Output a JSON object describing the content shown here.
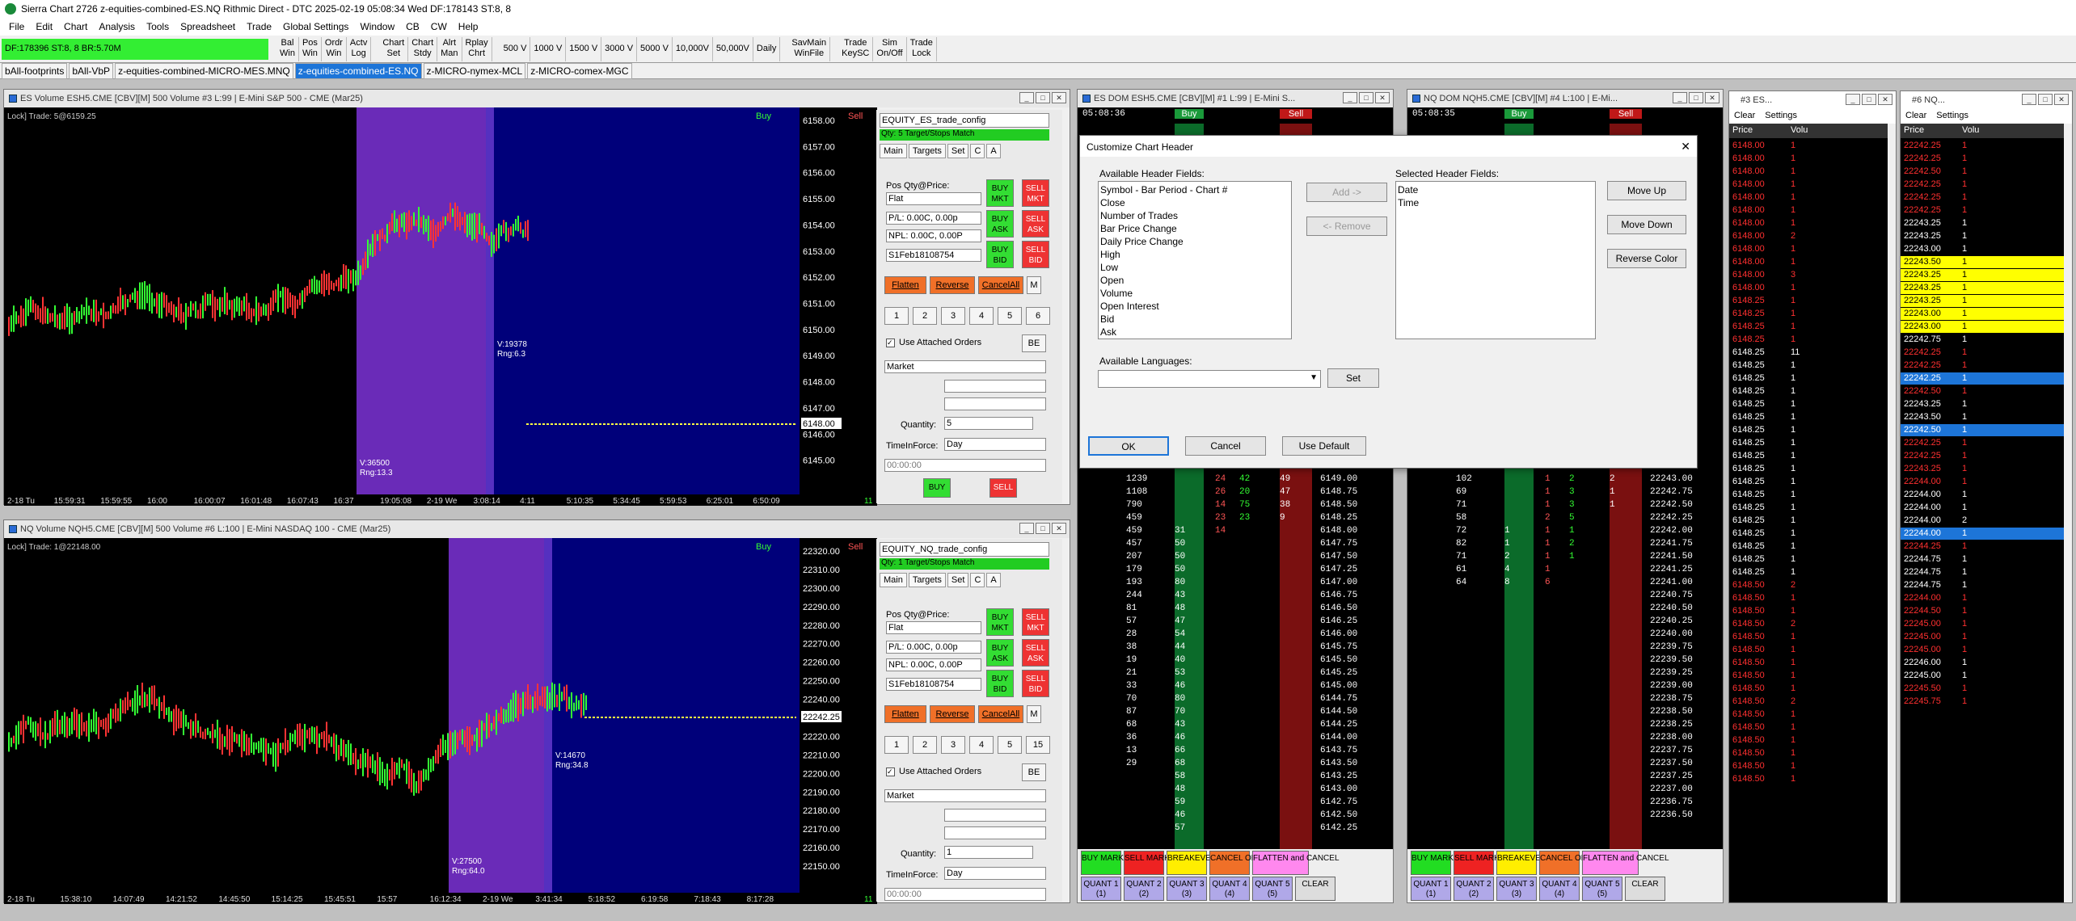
{
  "app": {
    "title": "Sierra Chart 2726 z-equities-combined-ES.NQ Rithmic Direct - DTC 2025-02-19  05:08:34 Wed DF:178143  ST:8, 8"
  },
  "menu": [
    "File",
    "Edit",
    "Chart",
    "Analysis",
    "Tools",
    "Spreadsheet",
    "Trade",
    "Global Settings",
    "Window",
    "CB",
    "CW",
    "Help"
  ],
  "toolbar": {
    "status": "DF:178396  ST:8, 8  BR:5.70M",
    "group1": [
      "Bal\nWin",
      "Pos\nWin",
      "Ordr\nWin",
      "Actv\nLog"
    ],
    "group2": [
      "Chart\nSet",
      "Chart\nStdy",
      "Alrt\nMan",
      "Rplay\nChrt"
    ],
    "group3": [
      "500 V",
      "1000 V",
      "1500 V",
      "3000 V",
      "5000 V",
      "10,000V",
      "50,000V",
      "Daily"
    ],
    "group4": [
      "SavMain\nWinFile"
    ],
    "group5": [
      "Trade\nKeySC",
      "Sim\nOn/Off",
      "Trade\nLock"
    ]
  },
  "chartbooks": [
    "bAll-footprints",
    "bAll-VbP",
    "z-equities-combined-MICRO-MES.MNQ",
    "z-equities-combined-ES.NQ",
    "z-MICRO-nymex-MCL",
    "z-MICRO-comex-MGC"
  ],
  "es_chart": {
    "title": "ES Volume ESH5.CME [CBV][M]  500 Volume #3 L:99 | E-Mini S&P 500 - CME (Mar25)",
    "header": "Lock] Trade: 5@6159.25",
    "buy_label": "Buy",
    "sell_label": "Sell",
    "prices": [
      "6158.00",
      "6157.00",
      "6156.00",
      "6155.00",
      "6154.00",
      "6153.00",
      "6152.00",
      "6151.00",
      "6150.00",
      "6149.00",
      "6148.00",
      "6147.00",
      "6146.00",
      "6145.00"
    ],
    "current_price": "6148.00",
    "times": [
      "2-18 Tu",
      "15:59:31",
      "15:59:55",
      "16:00",
      "16:00:07",
      "16:01:48",
      "16:07:43",
      "16:37",
      "19:05:08",
      "2-19 We",
      "3:08:14",
      "4:11",
      "5:10:35",
      "5:34:45",
      "5:59:53",
      "6:25:01",
      "6:50:09"
    ],
    "annot1": "V:36500\nRng:13.3",
    "annot2": "V:19378\nRng:6.3",
    "corner_count": "11"
  },
  "nq_chart": {
    "title": "NQ Volume NQH5.CME [CBV][M]  500 Volume #6 L:100 | E-Mini NASDAQ 100 - CME (Mar25)",
    "header": "Lock] Trade: 1@22148.00",
    "buy_label": "Buy",
    "sell_label": "Sell",
    "prices": [
      "22320.00",
      "22310.00",
      "22300.00",
      "22290.00",
      "22280.00",
      "22270.00",
      "22260.00",
      "22250.00",
      "22240.00",
      "22230.00",
      "22220.00",
      "22210.00",
      "22200.00",
      "22190.00",
      "22180.00",
      "22170.00",
      "22160.00",
      "22150.00"
    ],
    "current_price": "22242.25",
    "times": [
      "2-18 Tu",
      "15:38:10",
      "14:07:49",
      "14:21:52",
      "14:45:50",
      "15:14:25",
      "15:45:51",
      "15:57",
      "16:12:34",
      "2-19 We",
      "3:41:34",
      "5:18:52",
      "6:19:58",
      "7:18:43",
      "8:17:28"
    ],
    "annot1": "V:27500\nRng:64.0",
    "annot2": "V:14670\nRng:34.8",
    "corner_count": "11"
  },
  "es_trade": {
    "config": "EQUITY_ES_trade_config",
    "qty_line": "Qty: 5 Target/Stops Match",
    "tabs": [
      "Main",
      "Targets",
      "Set",
      "C",
      "A"
    ],
    "pos_label": "Pos Qty@Price:",
    "pos_value": "Flat",
    "pl": "P/L: 0.00C, 0.00p",
    "npl": "NPL: 0.00C, 0.00P",
    "account": "S1Feb18108754",
    "buy_mkt": "BUY\nMKT",
    "sell_mkt": "SELL\nMKT",
    "buy_ask": "BUY\nASK",
    "sell_ask": "SELL\nASK",
    "buy_bid": "BUY\nBID",
    "sell_bid": "SELL\nBID",
    "flatten": "Flatten",
    "reverse": "Reverse",
    "cancel_all": "CancelAll",
    "m": "M",
    "quants": [
      "1",
      "2",
      "3",
      "4",
      "5",
      "6"
    ],
    "use_attached": "Use Attached Orders",
    "be": "BE",
    "order_type": "Market",
    "quantity_label": "Quantity:",
    "quantity": "5",
    "tif_label": "TimeInForce:",
    "tif": "Day",
    "time": "00:00:00",
    "buy": "BUY",
    "sell": "SELL"
  },
  "nq_trade": {
    "config": "EQUITY_NQ_trade_config",
    "qty_line": "Qty: 1 Target/Stops Match",
    "tabs": [
      "Main",
      "Targets",
      "Set",
      "C",
      "A"
    ],
    "pos_label": "Pos Qty@Price:",
    "pos_value": "Flat",
    "pl": "P/L: 0.00C, 0.00p",
    "npl": "NPL: 0.00C, 0.00P",
    "account": "S1Feb18108754",
    "buy_mkt": "BUY\nMKT",
    "sell_mkt": "SELL\nMKT",
    "buy_ask": "BUY\nASK",
    "sell_ask": "SELL\nASK",
    "buy_bid": "BUY\nBID",
    "sell_bid": "SELL\nBID",
    "flatten": "Flatten",
    "reverse": "Reverse",
    "cancel_all": "CancelAll",
    "m": "M",
    "quants": [
      "1",
      "2",
      "3",
      "4",
      "5",
      "15"
    ],
    "use_attached": "Use Attached Orders",
    "be": "BE",
    "order_type": "Market",
    "quantity_label": "Quantity:",
    "quantity": "1",
    "tif_label": "TimeInForce:",
    "tif": "Day",
    "time": "00:00:00"
  },
  "es_dom": {
    "title": "ES DOM ESH5.CME [CBV][M] #1 L:99 | E-Mini S...",
    "time": "05:08:36",
    "buy": "Buy",
    "sell": "Sell",
    "rows": [
      [
        "1239",
        "",
        "24",
        "42",
        "49",
        "6149.00"
      ],
      [
        "1108",
        "",
        "26",
        "20",
        "47",
        "6148.75"
      ],
      [
        "790",
        "",
        "14",
        "75",
        "38",
        "6148.50"
      ],
      [
        "459",
        "",
        "23",
        "23",
        "9",
        "6148.25"
      ],
      [
        "459",
        "31",
        "14",
        "",
        "",
        "6148.00"
      ],
      [
        "457",
        "50",
        "",
        "",
        "",
        "6147.75"
      ],
      [
        "207",
        "50",
        "",
        "",
        "",
        "6147.50"
      ],
      [
        "179",
        "50",
        "",
        "",
        "",
        "6147.25"
      ],
      [
        "193",
        "80",
        "",
        "",
        "",
        "6147.00"
      ],
      [
        "244",
        "43",
        "",
        "",
        "",
        "6146.75"
      ],
      [
        "81",
        "48",
        "",
        "",
        "",
        "6146.50"
      ],
      [
        "57",
        "47",
        "",
        "",
        "",
        "6146.25"
      ],
      [
        "28",
        "54",
        "",
        "",
        "",
        "6146.00"
      ],
      [
        "38",
        "44",
        "",
        "",
        "",
        "6145.75"
      ],
      [
        "19",
        "40",
        "",
        "",
        "",
        "6145.50"
      ],
      [
        "21",
        "53",
        "",
        "",
        "",
        "6145.25"
      ],
      [
        "33",
        "46",
        "",
        "",
        "",
        "6145.00"
      ],
      [
        "70",
        "80",
        "",
        "",
        "",
        "6144.75"
      ],
      [
        "87",
        "70",
        "",
        "",
        "",
        "6144.50"
      ],
      [
        "68",
        "43",
        "",
        "",
        "",
        "6144.25"
      ],
      [
        "36",
        "46",
        "",
        "",
        "",
        "6144.00"
      ],
      [
        "13",
        "66",
        "",
        "",
        "",
        "6143.75"
      ],
      [
        "29",
        "68",
        "",
        "",
        "",
        "6143.50"
      ],
      [
        "",
        "58",
        "",
        "",
        "",
        "6143.25"
      ],
      [
        "",
        "48",
        "",
        "",
        "",
        "6143.00"
      ],
      [
        "",
        "59",
        "",
        "",
        "",
        "6142.75"
      ],
      [
        "",
        "46",
        "",
        "",
        "",
        "6142.50"
      ],
      [
        "",
        "57",
        "",
        "",
        "",
        "6142.25"
      ]
    ],
    "footer": [
      "BUY MARKET",
      "SELL MARKET",
      "BREAKEVEN",
      "CANCEL ORDERS",
      "FLATTEN and CANCEL",
      "QUANT 1\n(1)",
      "QUANT 2\n(2)",
      "QUANT 3\n(3)",
      "QUANT 4\n(4)",
      "QUANT 5\n(5)",
      "CLEAR"
    ]
  },
  "nq_dom": {
    "title": "NQ DOM NQH5.CME [CBV][M] #4 L:100 | E-Mi...",
    "time": "05:08:35",
    "buy": "Buy",
    "sell": "Sell",
    "rows": [
      [
        "102",
        "",
        "1",
        "2",
        "2",
        "22243.00"
      ],
      [
        "69",
        "",
        "1",
        "3",
        "1",
        "22242.75"
      ],
      [
        "71",
        "",
        "1",
        "3",
        "1",
        "22242.50"
      ],
      [
        "58",
        "",
        "2",
        "5",
        "",
        "22242.25"
      ],
      [
        "72",
        "1",
        "1",
        "1",
        "",
        "22242.00"
      ],
      [
        "82",
        "1",
        "1",
        "2",
        "",
        "22241.75"
      ],
      [
        "71",
        "2",
        "1",
        "1",
        "",
        "22241.50"
      ],
      [
        "61",
        "4",
        "1",
        "",
        "",
        "22241.25"
      ],
      [
        "64",
        "8",
        "6",
        "",
        "",
        "22241.00"
      ],
      [
        "",
        "",
        "",
        "",
        "",
        "22240.75"
      ],
      [
        "",
        "",
        "",
        "",
        "",
        "22240.50"
      ],
      [
        "",
        "",
        "",
        "",
        "",
        "22240.25"
      ],
      [
        "",
        "",
        "",
        "",
        "",
        "22240.00"
      ],
      [
        "",
        "",
        "",
        "",
        "",
        "22239.75"
      ],
      [
        "",
        "",
        "",
        "",
        "",
        "22239.50"
      ],
      [
        "",
        "",
        "",
        "",
        "",
        "22239.25"
      ],
      [
        "",
        "",
        "",
        "",
        "",
        "22239.00"
      ],
      [
        "",
        "",
        "",
        "",
        "",
        "22238.75"
      ],
      [
        "",
        "",
        "",
        "",
        "",
        "22238.50"
      ],
      [
        "",
        "",
        "",
        "",
        "",
        "22238.25"
      ],
      [
        "",
        "",
        "",
        "",
        "",
        "22238.00"
      ],
      [
        "",
        "",
        "",
        "",
        "",
        "22237.75"
      ],
      [
        "",
        "",
        "",
        "",
        "",
        "22237.50"
      ],
      [
        "",
        "",
        "",
        "",
        "",
        "22237.25"
      ],
      [
        "",
        "",
        "",
        "",
        "",
        "22237.00"
      ],
      [
        "",
        "",
        "",
        "",
        "",
        "22236.75"
      ],
      [
        "",
        "",
        "",
        "",
        "",
        "22236.50"
      ]
    ],
    "footer": [
      "BUY MARKET",
      "SELL MARKET",
      "BREAKEVEN",
      "CANCEL ORDERS",
      "FLATTEN and CANCEL",
      "QUANT 1\n(1)",
      "QUANT 2\n(2)",
      "QUANT 3\n(3)",
      "QUANT 4\n(4)",
      "QUANT 5\n(5)",
      "CLEAR"
    ]
  },
  "dialog": {
    "title": "Customize Chart Header",
    "available_label": "Available Header Fields:",
    "available": [
      "Symbol - Bar Period - Chart #",
      "Close",
      "Number of Trades",
      "Bar Price Change",
      "Daily Price Change",
      "High",
      "Low",
      "Open",
      "Volume",
      "Open Interest",
      "Bid",
      "Ask"
    ],
    "selected_label": "Selected Header Fields:",
    "selected": [
      "Date",
      "Time"
    ],
    "add": "Add ->",
    "remove": "<- Remove",
    "move_up": "Move Up",
    "move_down": "Move Down",
    "reverse_color": "Reverse Color",
    "languages_label": "Available Languages:",
    "set": "Set",
    "ok": "OK",
    "cancel": "Cancel",
    "use_default": "Use Default"
  },
  "es_ts": {
    "title": "#3 ES...",
    "clear": "Clear",
    "settings": "Settings",
    "col_price": "Price",
    "col_vol": "Volu",
    "rows": [
      [
        "6148.00",
        "1",
        "r"
      ],
      [
        "6148.00",
        "1",
        "r"
      ],
      [
        "6148.00",
        "1",
        "r"
      ],
      [
        "6148.00",
        "1",
        "r"
      ],
      [
        "6148.00",
        "1",
        "r"
      ],
      [
        "6148.00",
        "1",
        "r"
      ],
      [
        "6148.00",
        "1",
        "r"
      ],
      [
        "6148.00",
        "2",
        "r"
      ],
      [
        "6148.00",
        "1",
        "r"
      ],
      [
        "6148.00",
        "1",
        "r"
      ],
      [
        "6148.00",
        "3",
        "r"
      ],
      [
        "6148.00",
        "1",
        "r"
      ],
      [
        "6148.25",
        "1",
        "r"
      ],
      [
        "6148.25",
        "1",
        "r"
      ],
      [
        "6148.25",
        "1",
        "r"
      ],
      [
        "6148.25",
        "1",
        "r"
      ],
      [
        "6148.25",
        "11",
        "w"
      ],
      [
        "6148.25",
        "1",
        "w"
      ],
      [
        "6148.25",
        "1",
        "w"
      ],
      [
        "6148.25",
        "1",
        "w"
      ],
      [
        "6148.25",
        "1",
        "w"
      ],
      [
        "6148.25",
        "1",
        "w"
      ],
      [
        "6148.25",
        "1",
        "w"
      ],
      [
        "6148.25",
        "1",
        "w"
      ],
      [
        "6148.25",
        "1",
        "w"
      ],
      [
        "6148.25",
        "1",
        "w"
      ],
      [
        "6148.25",
        "1",
        "w"
      ],
      [
        "6148.25",
        "1",
        "w"
      ],
      [
        "6148.25",
        "1",
        "w"
      ],
      [
        "6148.25",
        "1",
        "w"
      ],
      [
        "6148.25",
        "1",
        "w"
      ],
      [
        "6148.25",
        "1",
        "w"
      ],
      [
        "6148.25",
        "1",
        "w"
      ],
      [
        "6148.25",
        "1",
        "w"
      ],
      [
        "6148.50",
        "2",
        "r"
      ],
      [
        "6148.50",
        "1",
        "r"
      ],
      [
        "6148.50",
        "1",
        "r"
      ],
      [
        "6148.50",
        "2",
        "r"
      ],
      [
        "6148.50",
        "1",
        "r"
      ],
      [
        "6148.50",
        "1",
        "r"
      ],
      [
        "6148.50",
        "1",
        "r"
      ],
      [
        "6148.50",
        "1",
        "r"
      ],
      [
        "6148.50",
        "1",
        "r"
      ],
      [
        "6148.50",
        "2",
        "r"
      ],
      [
        "6148.50",
        "1",
        "r"
      ],
      [
        "6148.50",
        "1",
        "r"
      ],
      [
        "6148.50",
        "1",
        "r"
      ],
      [
        "6148.50",
        "1",
        "r"
      ],
      [
        "6148.50",
        "1",
        "r"
      ],
      [
        "6148.50",
        "1",
        "r"
      ]
    ]
  },
  "nq_ts": {
    "title": "#6 NQ...",
    "clear": "Clear",
    "settings": "Settings",
    "col_price": "Price",
    "col_vol": "Volu",
    "rows": [
      [
        "22242.25",
        "1",
        "r"
      ],
      [
        "22242.25",
        "1",
        "r"
      ],
      [
        "22242.50",
        "1",
        "r"
      ],
      [
        "22242.25",
        "1",
        "r"
      ],
      [
        "22242.25",
        "1",
        "r"
      ],
      [
        "22242.25",
        "1",
        "r"
      ],
      [
        "22243.25",
        "1",
        "w"
      ],
      [
        "22243.25",
        "1",
        "w"
      ],
      [
        "22243.00",
        "1",
        "w"
      ],
      [
        "22243.50",
        "1",
        "y"
      ],
      [
        "22243.25",
        "1",
        "y"
      ],
      [
        "22243.25",
        "1",
        "y"
      ],
      [
        "22243.25",
        "1",
        "y"
      ],
      [
        "22243.00",
        "1",
        "y"
      ],
      [
        "22243.00",
        "1",
        "y"
      ],
      [
        "22242.75",
        "1",
        "w"
      ],
      [
        "22242.25",
        "1",
        "r"
      ],
      [
        "22242.25",
        "1",
        "r"
      ],
      [
        "22242.25",
        "1",
        "b"
      ],
      [
        "22242.50",
        "1",
        "r"
      ],
      [
        "22243.25",
        "1",
        "w"
      ],
      [
        "22243.50",
        "1",
        "w"
      ],
      [
        "22242.50",
        "1",
        "b"
      ],
      [
        "22242.25",
        "1",
        "r"
      ],
      [
        "22242.25",
        "1",
        "r"
      ],
      [
        "22243.25",
        "1",
        "r"
      ],
      [
        "22244.00",
        "1",
        "r"
      ],
      [
        "22244.00",
        "1",
        "w"
      ],
      [
        "22244.00",
        "1",
        "w"
      ],
      [
        "22244.00",
        "2",
        "w"
      ],
      [
        "22244.00",
        "1",
        "b"
      ],
      [
        "22244.25",
        "1",
        "r"
      ],
      [
        "22244.75",
        "1",
        "w"
      ],
      [
        "22244.75",
        "1",
        "w"
      ],
      [
        "22244.75",
        "1",
        "w"
      ],
      [
        "22244.00",
        "1",
        "r"
      ],
      [
        "22244.50",
        "1",
        "r"
      ],
      [
        "22245.00",
        "1",
        "r"
      ],
      [
        "22245.00",
        "1",
        "r"
      ],
      [
        "22245.00",
        "1",
        "r"
      ],
      [
        "22246.00",
        "1",
        "w"
      ],
      [
        "22245.00",
        "1",
        "w"
      ],
      [
        "22245.50",
        "1",
        "r"
      ],
      [
        "22245.75",
        "1",
        "r"
      ]
    ]
  },
  "colors": {
    "green": "#33dd33",
    "red": "#ee3333",
    "purple": "#6a2bb8",
    "navy": "#00007a",
    "yellow": "#ffff00",
    "blue": "#1d75d8"
  }
}
